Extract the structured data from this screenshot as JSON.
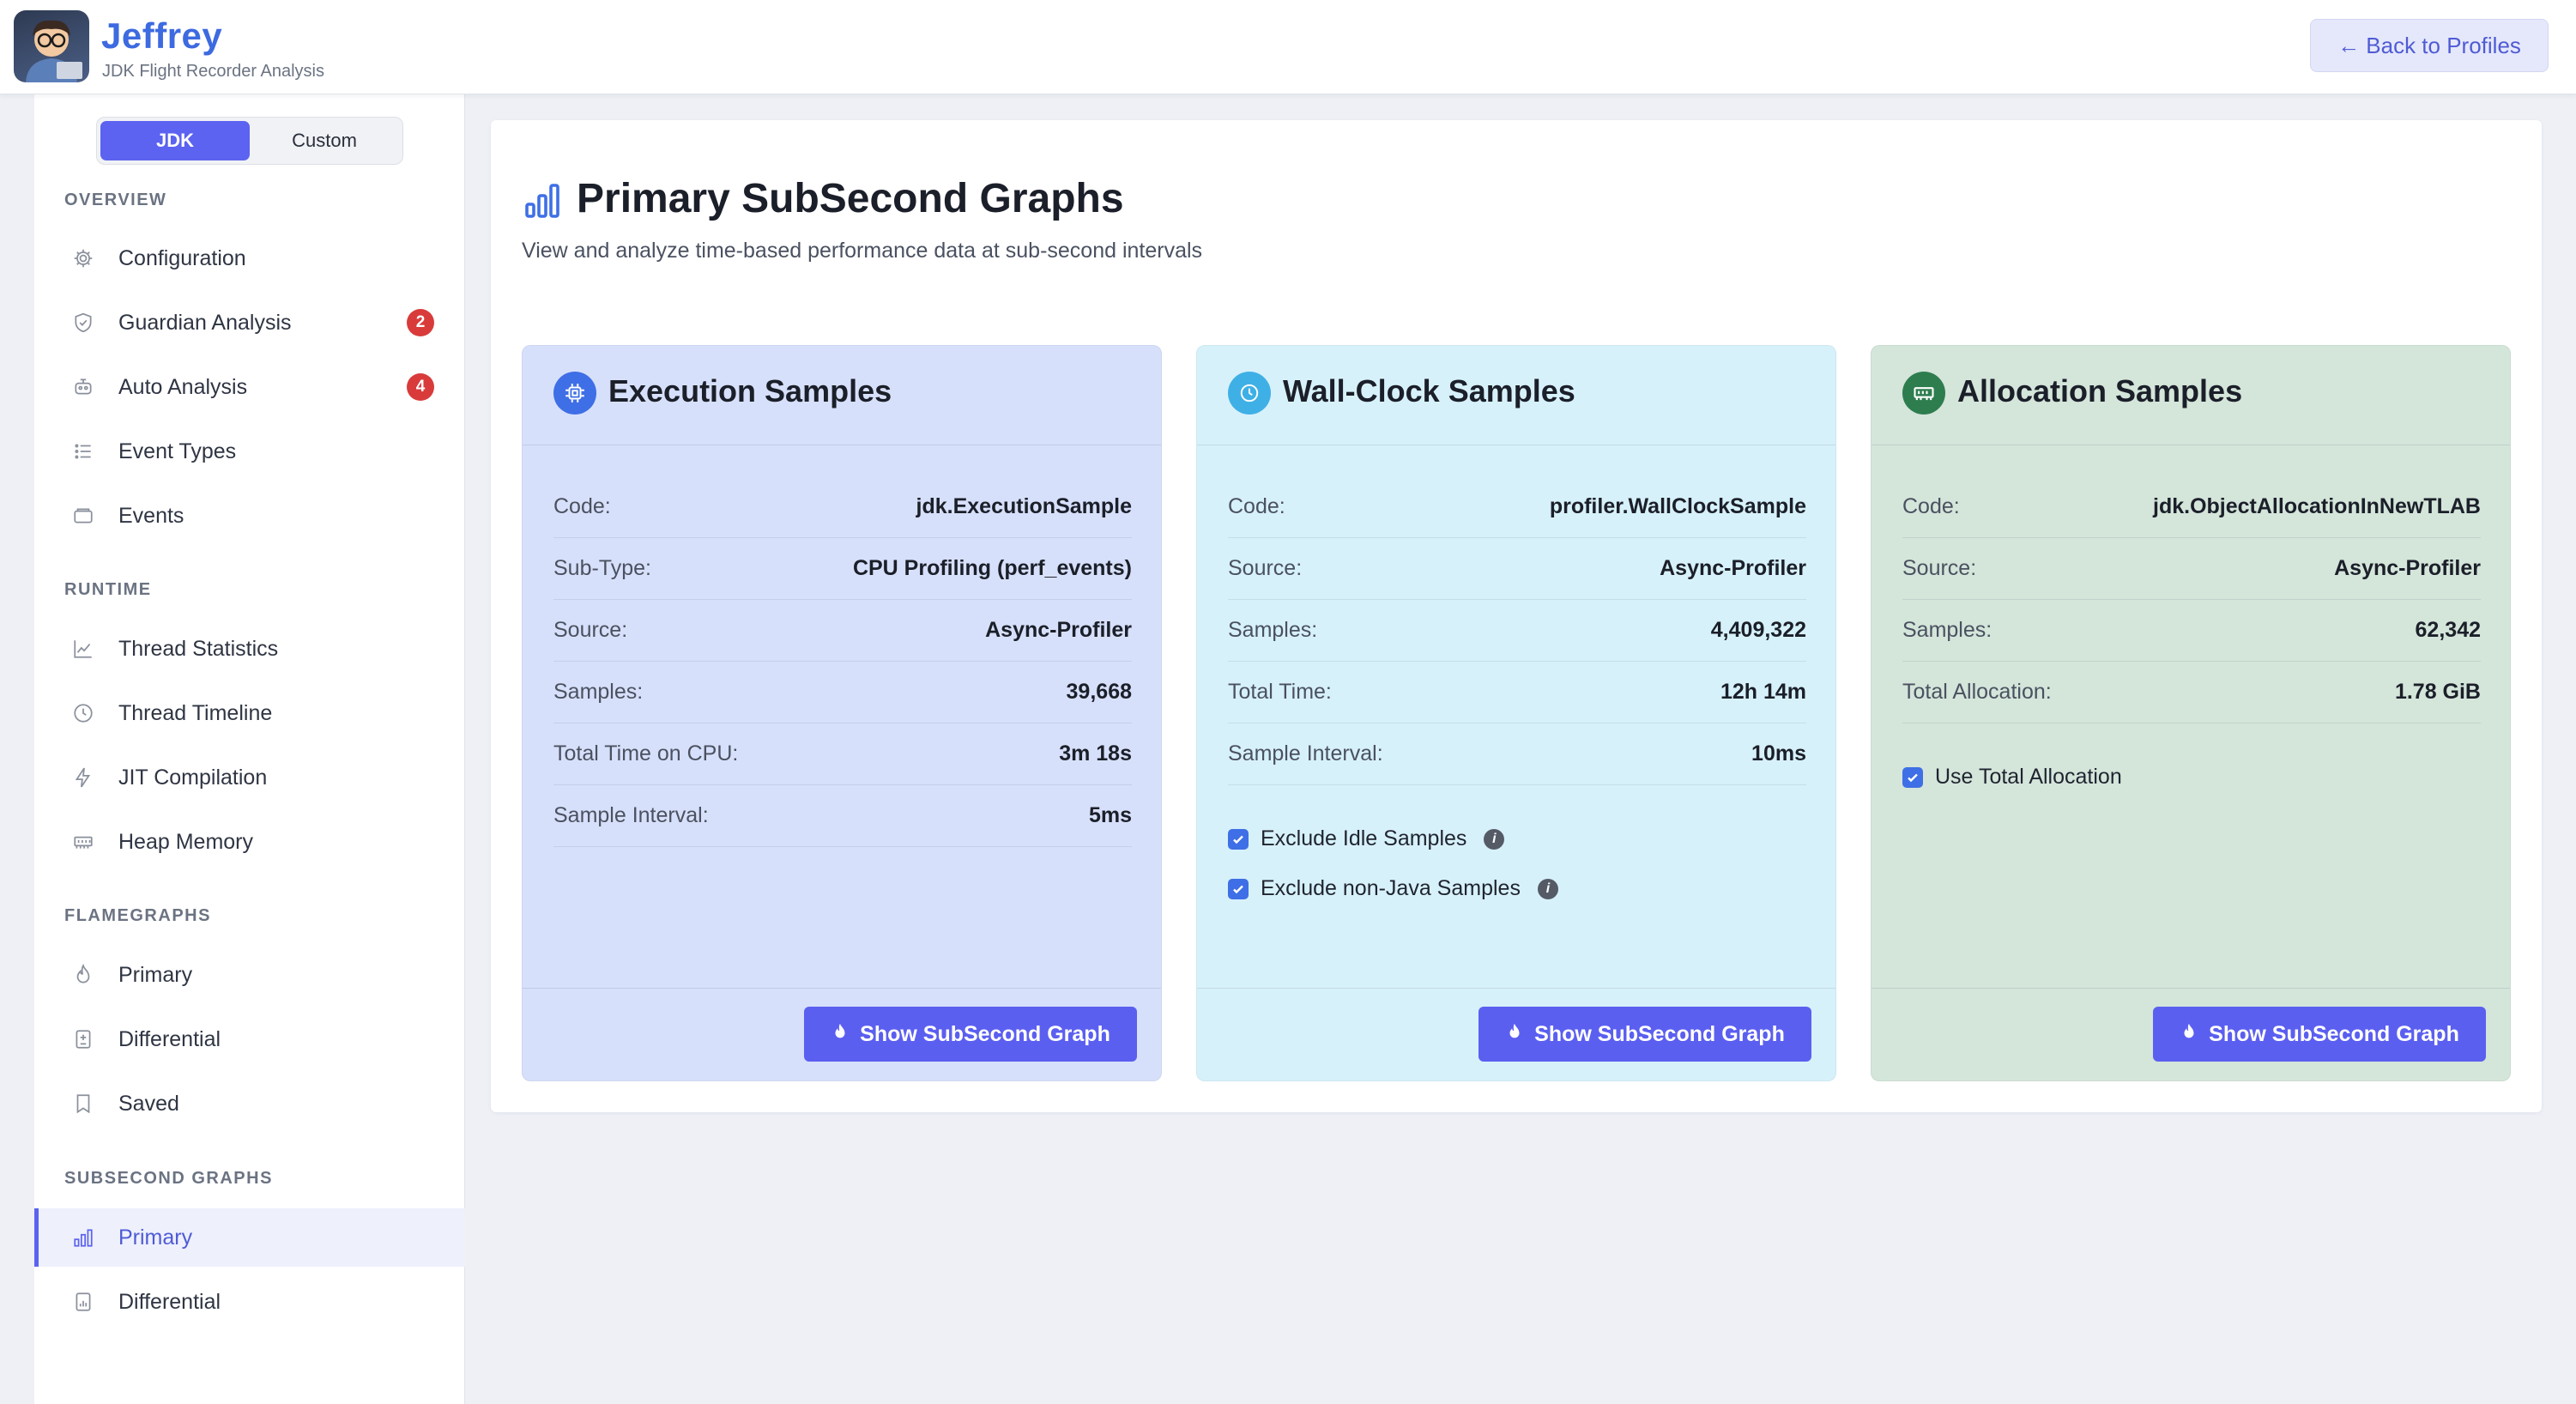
{
  "header": {
    "brand_title": "Jeffrey",
    "brand_subtitle": "JDK Flight Recorder Analysis",
    "back_button": "← Back to Profiles"
  },
  "sidebar": {
    "toggle": {
      "jdk": "JDK",
      "custom": "Custom",
      "active": "JDK"
    },
    "sections": {
      "overview": "OVERVIEW",
      "runtime": "RUNTIME",
      "flamegraphs": "FLAMEGRAPHS",
      "subsecond": "SUBSECOND GRAPHS"
    },
    "items": {
      "configuration": {
        "label": "Configuration",
        "icon": "gear-icon"
      },
      "guardian": {
        "label": "Guardian Analysis",
        "icon": "shield-icon",
        "badge": "2"
      },
      "auto": {
        "label": "Auto Analysis",
        "icon": "robot-icon",
        "badge": "4"
      },
      "event_types": {
        "label": "Event Types",
        "icon": "list-icon"
      },
      "events": {
        "label": "Events",
        "icon": "inbox-icon"
      },
      "thread_statistics": {
        "label": "Thread Statistics",
        "icon": "line-chart-icon"
      },
      "thread_timeline": {
        "label": "Thread Timeline",
        "icon": "clock-icon"
      },
      "jit_compilation": {
        "label": "JIT Compilation",
        "icon": "lightning-icon"
      },
      "heap_memory": {
        "label": "Heap Memory",
        "icon": "memory-icon"
      },
      "fg_primary": {
        "label": "Primary",
        "icon": "fire-icon"
      },
      "fg_differential": {
        "label": "Differential",
        "icon": "file-diff-icon"
      },
      "fg_saved": {
        "label": "Saved",
        "icon": "bookmark-icon"
      },
      "ss_primary": {
        "label": "Primary",
        "icon": "bar-chart-icon",
        "active": true
      },
      "ss_differential": {
        "label": "Differential",
        "icon": "file-chart-icon"
      }
    }
  },
  "main": {
    "title": "Primary SubSecond Graphs",
    "subtitle": "View and analyze time-based performance data at sub-second intervals",
    "button_label": "Show SubSecond Graph",
    "cards": {
      "execution": {
        "title": "Execution Samples",
        "icon": "cpu-icon",
        "color": "#3f6fe6",
        "rows": [
          {
            "key": "Code:",
            "value": "jdk.ExecutionSample"
          },
          {
            "key": "Sub-Type:",
            "value": "CPU Profiling (perf_events)"
          },
          {
            "key": "Source:",
            "value": "Async-Profiler"
          },
          {
            "key": "Samples:",
            "value": "39,668"
          },
          {
            "key": "Total Time on CPU:",
            "value": "3m 18s"
          },
          {
            "key": "Sample Interval:",
            "value": "5ms"
          }
        ]
      },
      "wallclock": {
        "title": "Wall-Clock Samples",
        "icon": "clock-icon",
        "color": "#3fb0e6",
        "rows": [
          {
            "key": "Code:",
            "value": "profiler.WallClockSample"
          },
          {
            "key": "Source:",
            "value": "Async-Profiler"
          },
          {
            "key": "Samples:",
            "value": "4,409,322"
          },
          {
            "key": "Total Time:",
            "value": "12h 14m"
          },
          {
            "key": "Sample Interval:",
            "value": "10ms"
          }
        ],
        "checkboxes": [
          {
            "label": "Exclude Idle Samples",
            "checked": true
          },
          {
            "label": "Exclude non-Java Samples",
            "checked": true
          }
        ]
      },
      "allocation": {
        "title": "Allocation Samples",
        "icon": "memory-icon",
        "color": "#2e7d4f",
        "rows": [
          {
            "key": "Code:",
            "value": "jdk.ObjectAllocationInNewTLAB"
          },
          {
            "key": "Source:",
            "value": "Async-Profiler"
          },
          {
            "key": "Samples:",
            "value": "62,342"
          },
          {
            "key": "Total Allocation:",
            "value": "1.78 GiB"
          }
        ],
        "checkboxes": [
          {
            "label": "Use Total Allocation",
            "checked": true
          }
        ]
      }
    }
  }
}
